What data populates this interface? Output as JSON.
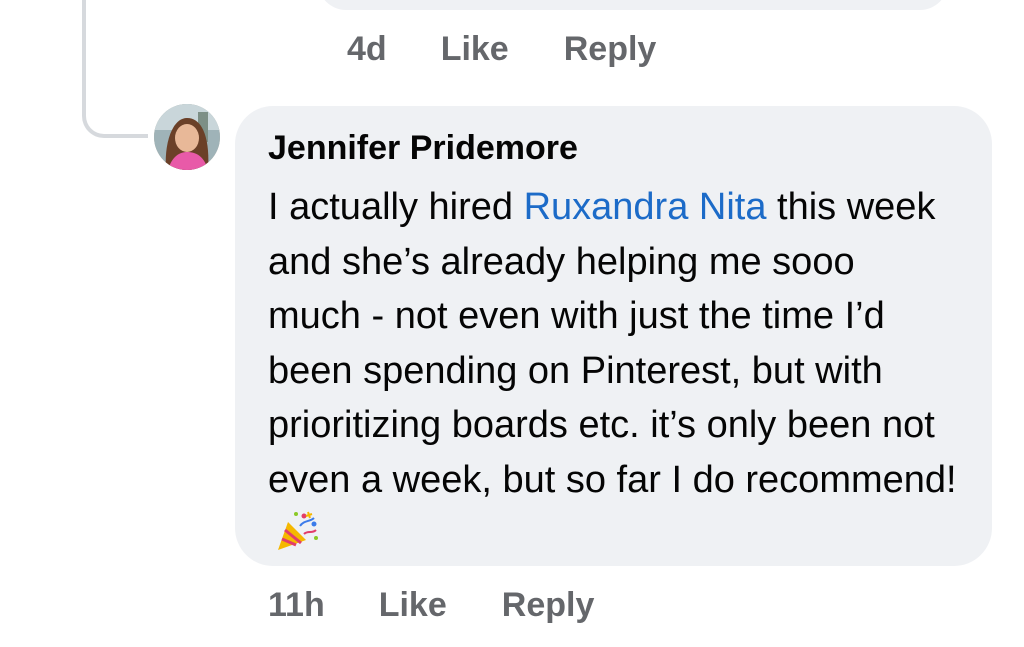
{
  "previous_comment": {
    "timestamp": "4d",
    "like_label": "Like",
    "reply_label": "Reply"
  },
  "comment": {
    "author": "Jennifer Pridemore",
    "text_before_mention": "I actually hired ",
    "mention": "Ruxandra Nita",
    "text_after_mention": " this week and she’s already helping me sooo much - not even with just the time I’d been spending on Pinterest, but with prioritizing boards etc. it’s only been not even a week, but so far I do recommend!",
    "emoji": "party-popper-icon",
    "timestamp": "11h",
    "like_label": "Like",
    "reply_label": "Reply"
  },
  "colors": {
    "bubble_bg": "#eff1f4",
    "mention": "#1c6bc8",
    "meta_text": "#65676b",
    "thread_line": "#d6d9dd"
  }
}
